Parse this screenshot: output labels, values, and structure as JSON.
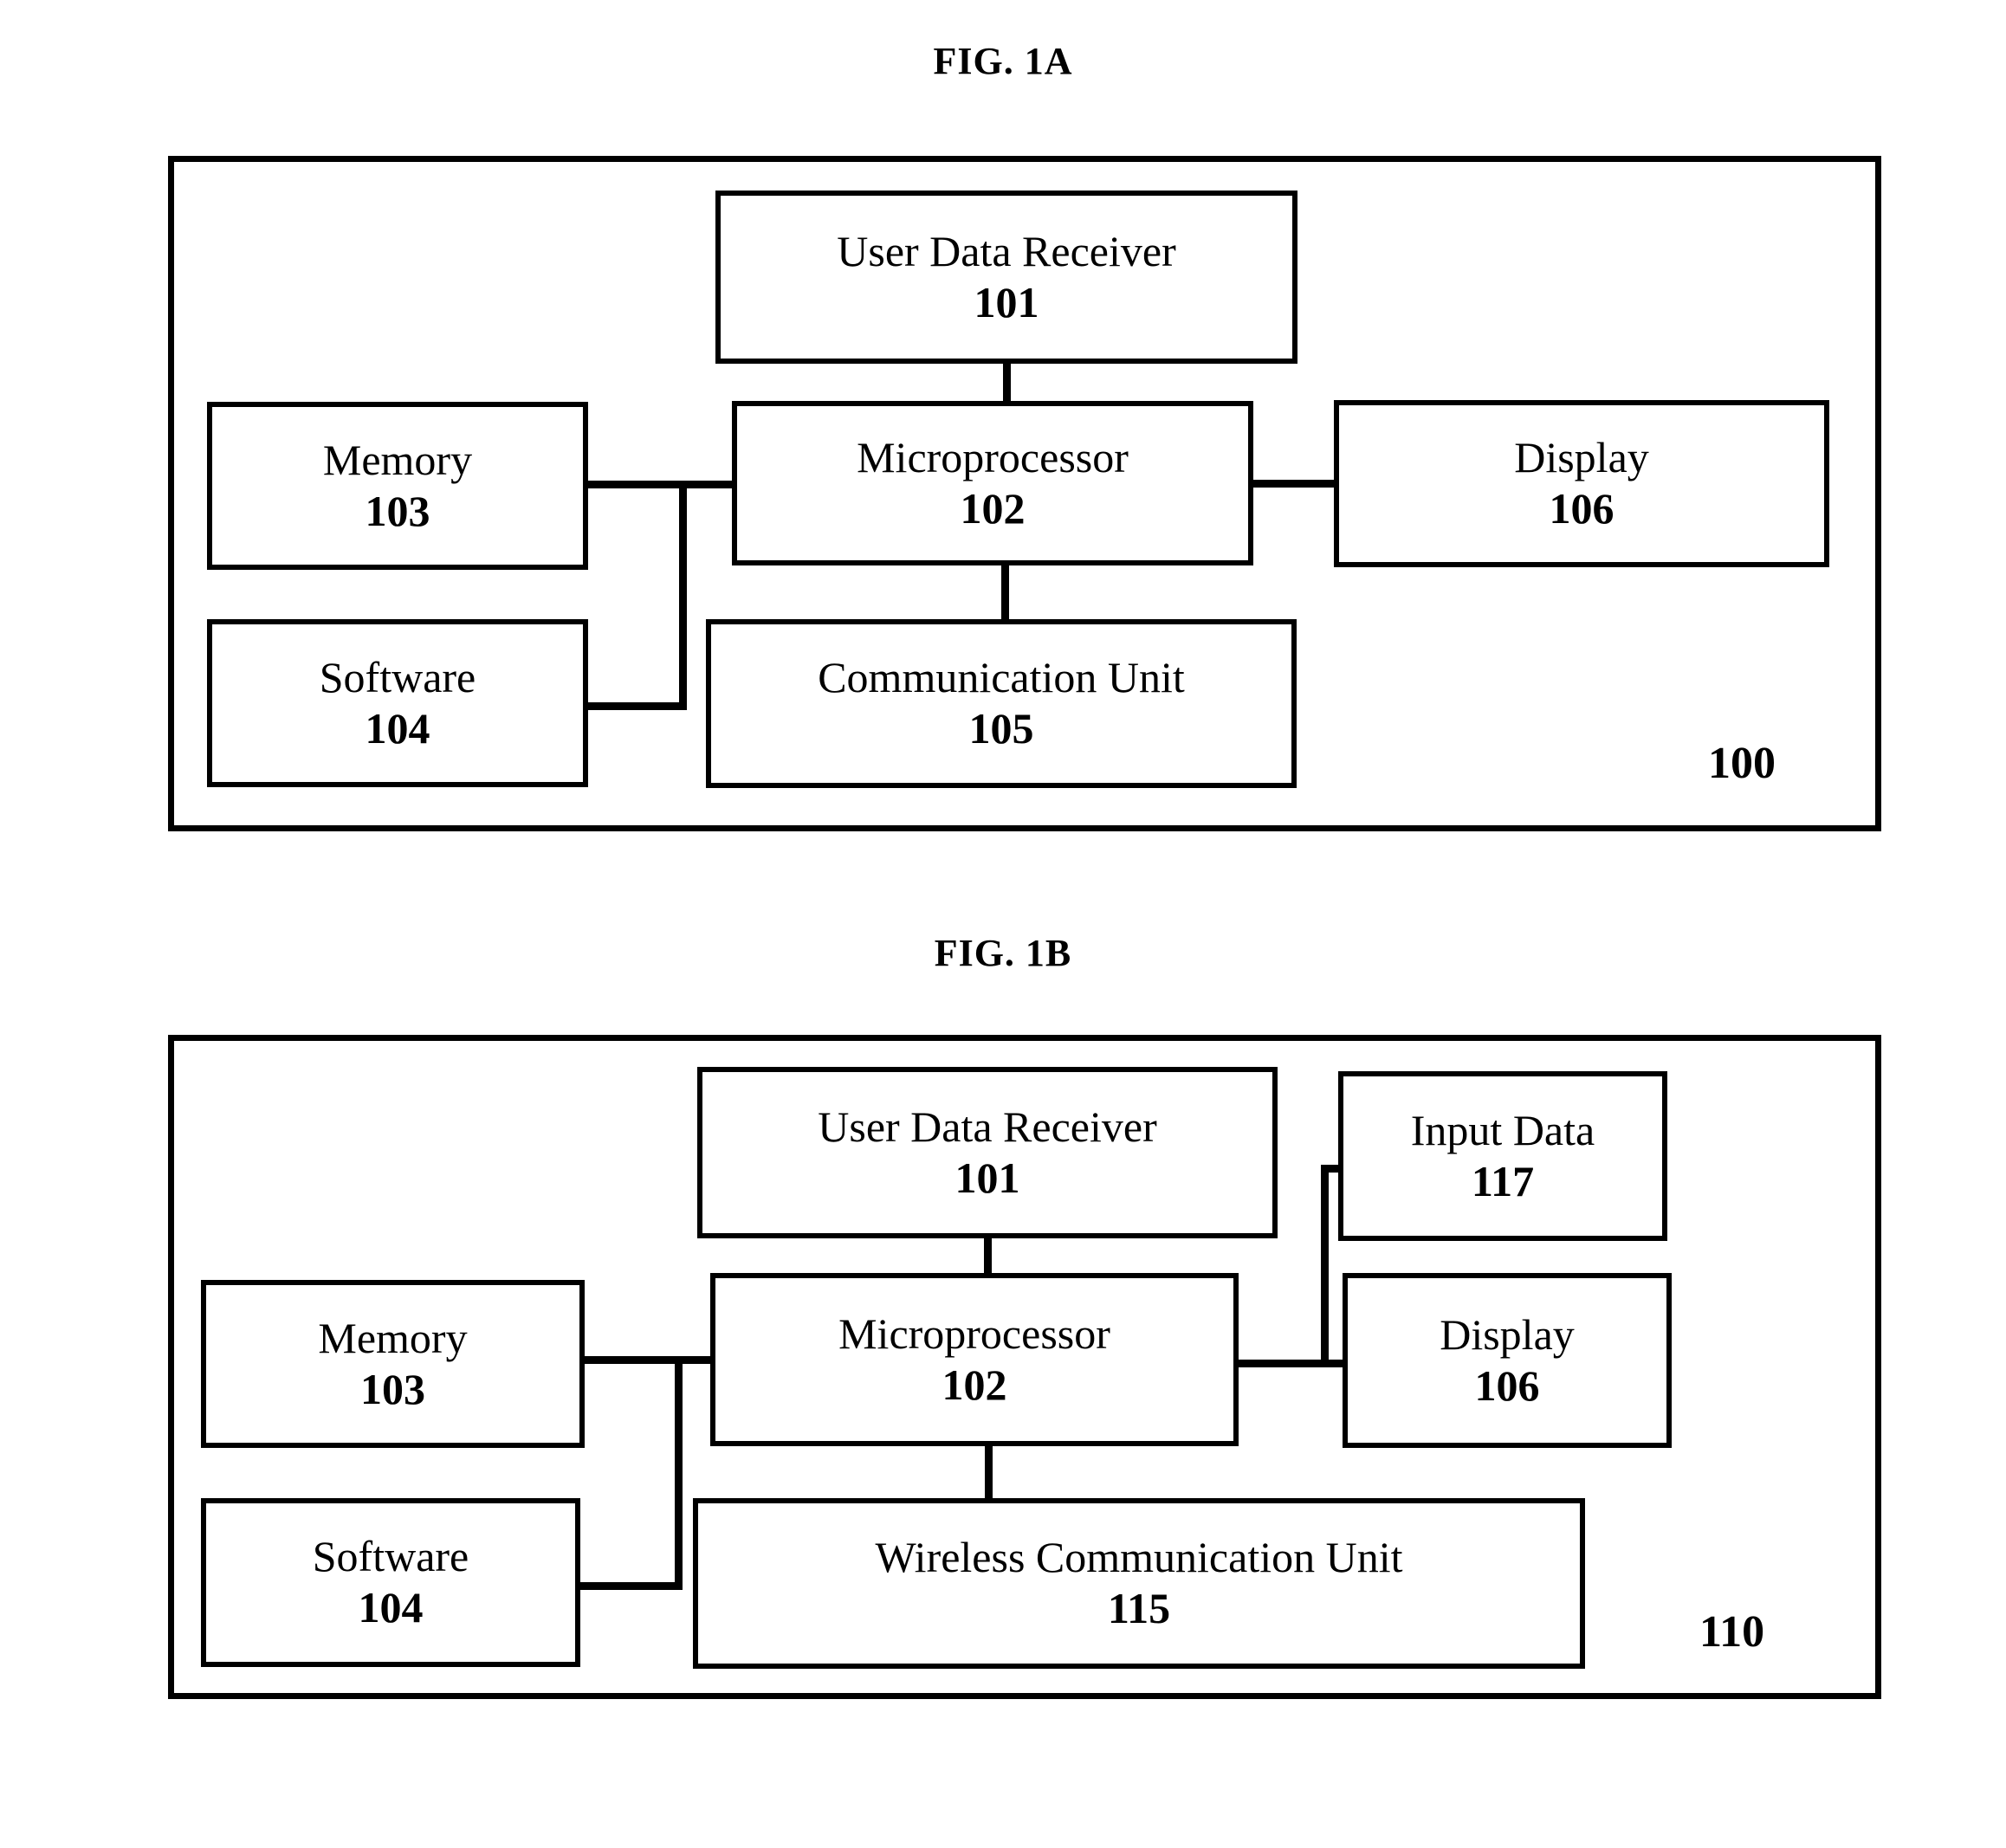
{
  "figures": [
    {
      "id": "fig-1a",
      "title": "FIG. 1A",
      "system_ref": "100",
      "boxes": [
        {
          "key": "user_data_receiver",
          "label": "User Data Receiver",
          "ref": "101"
        },
        {
          "key": "memory",
          "label": "Memory",
          "ref": "103"
        },
        {
          "key": "microprocessor",
          "label": "Microprocessor",
          "ref": "102"
        },
        {
          "key": "display",
          "label": "Display",
          "ref": "106"
        },
        {
          "key": "software",
          "label": "Software",
          "ref": "104"
        },
        {
          "key": "communication_unit",
          "label": "Communication Unit",
          "ref": "105"
        }
      ],
      "connections": [
        "user_data_receiver-microprocessor",
        "memory-microprocessor",
        "microprocessor-display",
        "microprocessor-communication_unit",
        "memory_bus-software"
      ]
    },
    {
      "id": "fig-1b",
      "title": "FIG. 1B",
      "system_ref": "110",
      "boxes": [
        {
          "key": "user_data_receiver",
          "label": "User Data Receiver",
          "ref": "101"
        },
        {
          "key": "input_data",
          "label": "Input Data",
          "ref": "117"
        },
        {
          "key": "memory",
          "label": "Memory",
          "ref": "103"
        },
        {
          "key": "microprocessor",
          "label": "Microprocessor",
          "ref": "102"
        },
        {
          "key": "display",
          "label": "Display",
          "ref": "106"
        },
        {
          "key": "software",
          "label": "Software",
          "ref": "104"
        },
        {
          "key": "wireless_communication_unit",
          "label": "Wireless Communication Unit",
          "ref": "115"
        }
      ],
      "connections": [
        "user_data_receiver-microprocessor",
        "memory-microprocessor",
        "microprocessor-display",
        "microprocessor-wireless_communication_unit",
        "memory_bus-software",
        "input_data-microprocessor_display_bus"
      ]
    }
  ],
  "colors": {
    "line": "#000000",
    "background": "#ffffff"
  }
}
